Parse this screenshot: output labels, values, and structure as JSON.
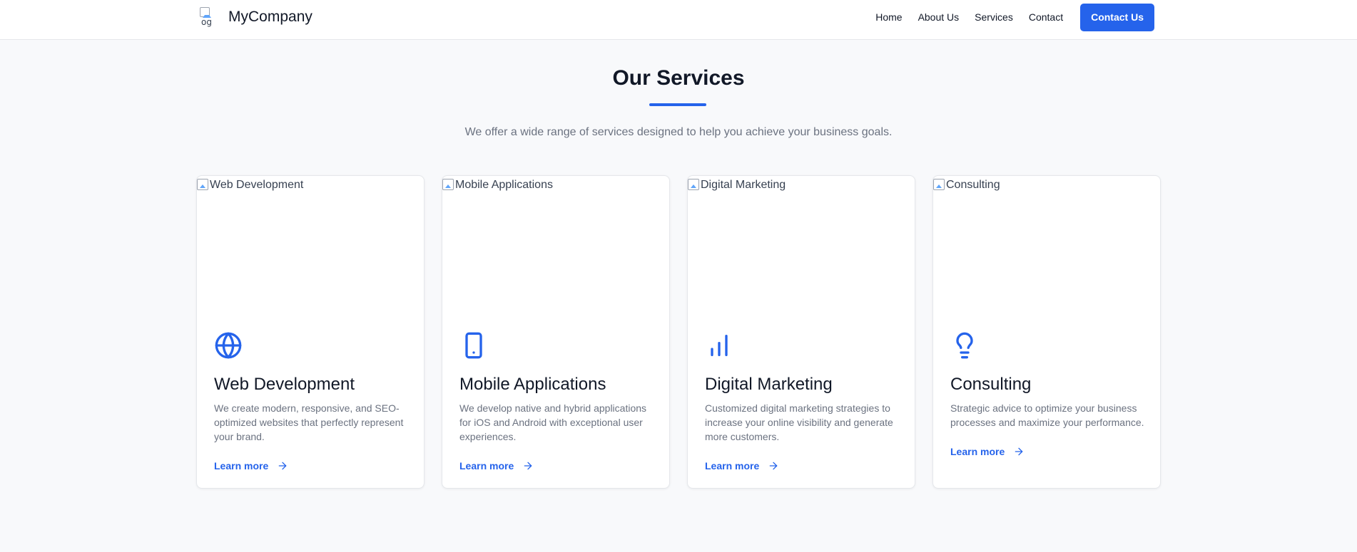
{
  "header": {
    "logo_alt": "og",
    "brand": "MyCompany",
    "nav": [
      "Home",
      "About Us",
      "Services",
      "Contact"
    ],
    "cta_label": "Contact Us"
  },
  "section": {
    "title": "Our Services",
    "subtitle": "We offer a wide range of services designed to help you achieve your business goals."
  },
  "cards": [
    {
      "image_alt": "Web Development",
      "icon": "globe-icon",
      "title": "Web Development",
      "description": "We create modern, responsive, and SEO-optimized websites that perfectly represent your brand.",
      "link": "Learn more"
    },
    {
      "image_alt": "Mobile Applications",
      "icon": "smartphone-icon",
      "title": "Mobile Applications",
      "description": "We develop native and hybrid applications for iOS and Android with exceptional user experiences.",
      "link": "Learn more"
    },
    {
      "image_alt": "Digital Marketing",
      "icon": "bar-chart-icon",
      "title": "Digital Marketing",
      "description": "Customized digital marketing strategies to increase your online visibility and generate more customers.",
      "link": "Learn more"
    },
    {
      "image_alt": "Consulting",
      "icon": "lightbulb-icon",
      "title": "Consulting",
      "description": "Strategic advice to optimize your business processes and maximize your performance.",
      "link": "Learn more"
    }
  ],
  "colors": {
    "accent": "#2563eb",
    "background": "#f8f9fb",
    "text": "#111827",
    "muted": "#6b7280"
  }
}
